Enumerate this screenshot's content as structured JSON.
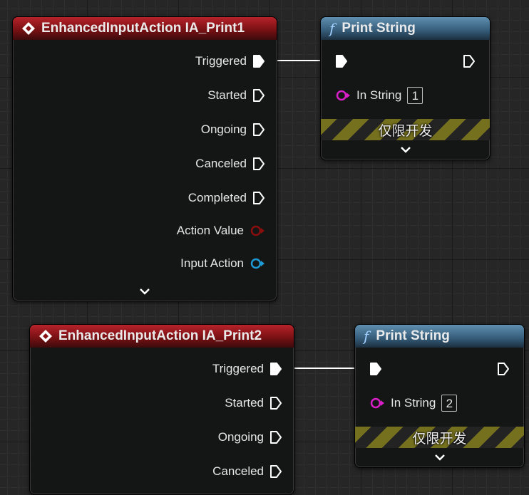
{
  "colors": {
    "event_header": "#9b1b20",
    "function_header": "#4a7898",
    "action_value_pin": "#8b0e0e",
    "input_action_pin": "#1e9ad6",
    "string_pin": "#d81fc8",
    "dev_stripe": "#75701e"
  },
  "nodes": [
    {
      "title": "EnhancedInputAction IA_Print1",
      "icon": "event-diamond-icon",
      "pins": [
        {
          "label": "Triggered",
          "type": "exec",
          "connected": true
        },
        {
          "label": "Started",
          "type": "exec",
          "connected": false
        },
        {
          "label": "Ongoing",
          "type": "exec",
          "connected": false
        },
        {
          "label": "Canceled",
          "type": "exec",
          "connected": false
        },
        {
          "label": "Completed",
          "type": "exec",
          "connected": false
        },
        {
          "label": "Action Value",
          "type": "data"
        },
        {
          "label": "Input Action",
          "type": "data"
        }
      ]
    },
    {
      "title": "Print String",
      "icon": "function-icon",
      "in_string_label": "In String",
      "in_string_value": "1",
      "dev_label": "仅限开发"
    },
    {
      "title": "EnhancedInputAction IA_Print2",
      "icon": "event-diamond-icon",
      "pins": [
        {
          "label": "Triggered",
          "type": "exec",
          "connected": true
        },
        {
          "label": "Started",
          "type": "exec",
          "connected": false
        },
        {
          "label": "Ongoing",
          "type": "exec",
          "connected": false
        },
        {
          "label": "Canceled",
          "type": "exec",
          "connected": false
        }
      ]
    },
    {
      "title": "Print String",
      "icon": "function-icon",
      "in_string_label": "In String",
      "in_string_value": "2",
      "dev_label": "仅限开发"
    }
  ],
  "icons": {
    "fn_glyph": "f",
    "expand": "chevron-down-icon"
  }
}
